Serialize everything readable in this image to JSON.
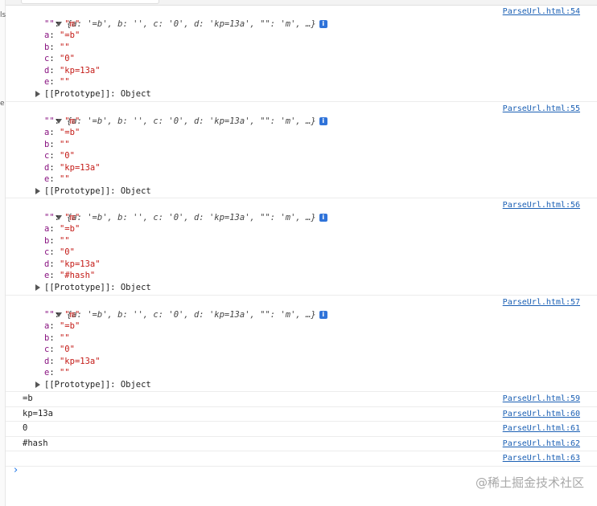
{
  "left_gutter_marks": [
    "ls",
    "e"
  ],
  "entries": [
    {
      "summary": "{a: '=b', b: '', c: '0', d: 'kp=13a', \"\": 'm', …}",
      "source": "ParseUrl.html:54",
      "props": [
        {
          "key": "\"\"",
          "value": "\"m\""
        },
        {
          "key": "a",
          "value": "\"=b\""
        },
        {
          "key": "b",
          "value": "\"\""
        },
        {
          "key": "c",
          "value": "\"0\""
        },
        {
          "key": "d",
          "value": "\"kp=13a\""
        },
        {
          "key": "e",
          "value": "\"\""
        }
      ],
      "proto": "[[Prototype]]: Object"
    },
    {
      "summary": "{a: '=b', b: '', c: '0', d: 'kp=13a', \"\": 'm', …}",
      "source": "ParseUrl.html:55",
      "props": [
        {
          "key": "\"\"",
          "value": "\"m\""
        },
        {
          "key": "a",
          "value": "\"=b\""
        },
        {
          "key": "b",
          "value": "\"\""
        },
        {
          "key": "c",
          "value": "\"0\""
        },
        {
          "key": "d",
          "value": "\"kp=13a\""
        },
        {
          "key": "e",
          "value": "\"\""
        }
      ],
      "proto": "[[Prototype]]: Object"
    },
    {
      "summary": "{a: '=b', b: '', c: '0', d: 'kp=13a', \"\": 'm', …}",
      "source": "ParseUrl.html:56",
      "props": [
        {
          "key": "\"\"",
          "value": "\"m\""
        },
        {
          "key": "a",
          "value": "\"=b\""
        },
        {
          "key": "b",
          "value": "\"\""
        },
        {
          "key": "c",
          "value": "\"0\""
        },
        {
          "key": "d",
          "value": "\"kp=13a\""
        },
        {
          "key": "e",
          "value": "\"#hash\""
        }
      ],
      "proto": "[[Prototype]]: Object"
    },
    {
      "summary": "{a: '=b', b: '', c: '0', d: 'kp=13a', \"\": 'm', …}",
      "source": "ParseUrl.html:57",
      "props": [
        {
          "key": "\"\"",
          "value": "\"m\""
        },
        {
          "key": "a",
          "value": "\"=b\""
        },
        {
          "key": "b",
          "value": "\"\""
        },
        {
          "key": "c",
          "value": "\"0\""
        },
        {
          "key": "d",
          "value": "\"kp=13a\""
        },
        {
          "key": "e",
          "value": "\"\""
        }
      ],
      "proto": "[[Prototype]]: Object"
    }
  ],
  "logs": [
    {
      "text": "=b",
      "source": "ParseUrl.html:59"
    },
    {
      "text": "kp=13a",
      "source": "ParseUrl.html:60"
    },
    {
      "text": "0",
      "source": "ParseUrl.html:61"
    },
    {
      "text": "#hash",
      "source": "ParseUrl.html:62"
    },
    {
      "text": "",
      "source": "ParseUrl.html:63"
    }
  ],
  "info_icon_label": "i",
  "prompt_symbol": "›",
  "watermark": "@稀土掘金技术社区"
}
